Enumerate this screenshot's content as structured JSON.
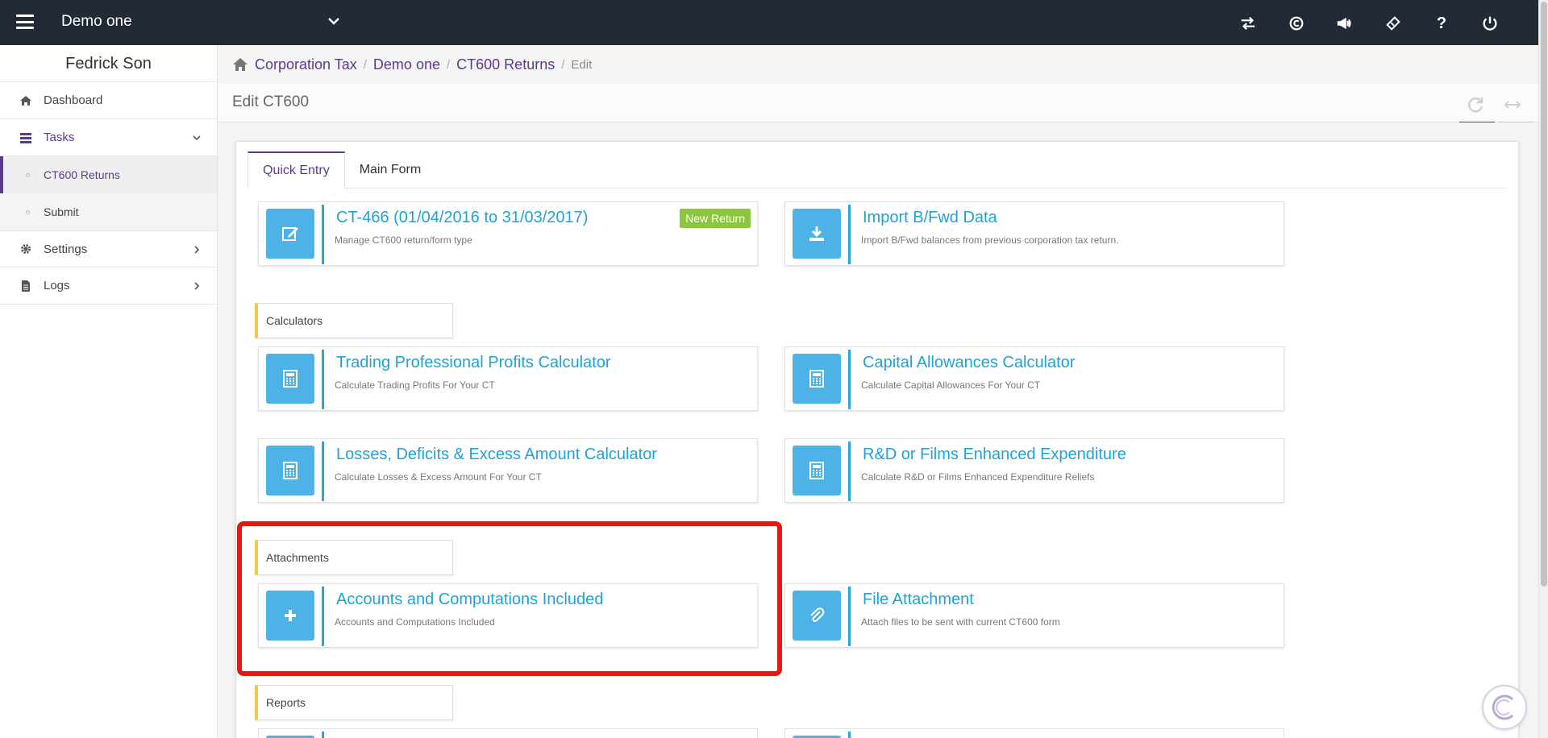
{
  "topbar": {
    "company": "Demo one",
    "icons": [
      "swap-icon",
      "copyright-icon",
      "megaphone-icon",
      "ticket-icon",
      "help-icon",
      "power-icon"
    ]
  },
  "sidebar": {
    "user_name": "Fedrick Son",
    "items": [
      {
        "label": "Dashboard",
        "icon": "home-icon"
      },
      {
        "label": "Tasks",
        "icon": "tasks-icon",
        "expanded": true
      },
      {
        "label": "CT600 Returns",
        "active": true
      },
      {
        "label": "Submit"
      },
      {
        "label": "Settings",
        "icon": "gear-icon"
      },
      {
        "label": "Logs",
        "icon": "document-icon"
      }
    ]
  },
  "breadcrumb": {
    "items": [
      "Corporation Tax",
      "Demo one",
      "CT600 Returns"
    ],
    "current": "Edit"
  },
  "page": {
    "title": "Edit CT600"
  },
  "tabs": [
    {
      "label": "Quick Entry",
      "active": true
    },
    {
      "label": "Main Form"
    }
  ],
  "cards": {
    "ct466": {
      "title": "CT-466 (01/04/2016 to 31/03/2017)",
      "subtitle": "Manage CT600 return/form type",
      "badge": "New Return",
      "icon": "edit-icon"
    },
    "import": {
      "title": "Import B/Fwd Data",
      "subtitle": "Import B/Fwd balances from previous corporation tax return.",
      "icon": "download-icon"
    },
    "trading": {
      "title": "Trading Professional Profits Calculator",
      "subtitle": "Calculate Trading Profits For Your CT",
      "icon": "calculator-icon"
    },
    "capital": {
      "title": "Capital Allowances Calculator",
      "subtitle": "Calculate Capital Allowances For Your CT",
      "icon": "calculator-icon"
    },
    "losses": {
      "title": "Losses, Deficits & Excess Amount Calculator",
      "subtitle": "Calculate Losses & Excess Amount For Your CT",
      "icon": "calculator-icon"
    },
    "rnd": {
      "title": "R&D or Films Enhanced Expenditure",
      "subtitle": "Calculate R&D or Films Enhanced Expenditure Reliefs",
      "icon": "calculator-icon"
    },
    "accounts": {
      "title": "Accounts and Computations Included",
      "subtitle": "Accounts and Computations Included",
      "icon": "plus-icon"
    },
    "file": {
      "title": "File Attachment",
      "subtitle": "Attach files to be sent with current CT600 form",
      "icon": "paperclip-icon"
    }
  },
  "sections": {
    "calculators": "Calculators",
    "attachments": "Attachments",
    "reports": "Reports"
  },
  "colors": {
    "topbar": "#222a35",
    "accent_purple": "#5b3a8c",
    "card_icon_blue": "#4db3e6",
    "card_title_blue": "#1ea3d6",
    "badge_green": "#8cc63f",
    "section_yellow": "#f2c94c",
    "highlight_red": "#e01b12"
  }
}
